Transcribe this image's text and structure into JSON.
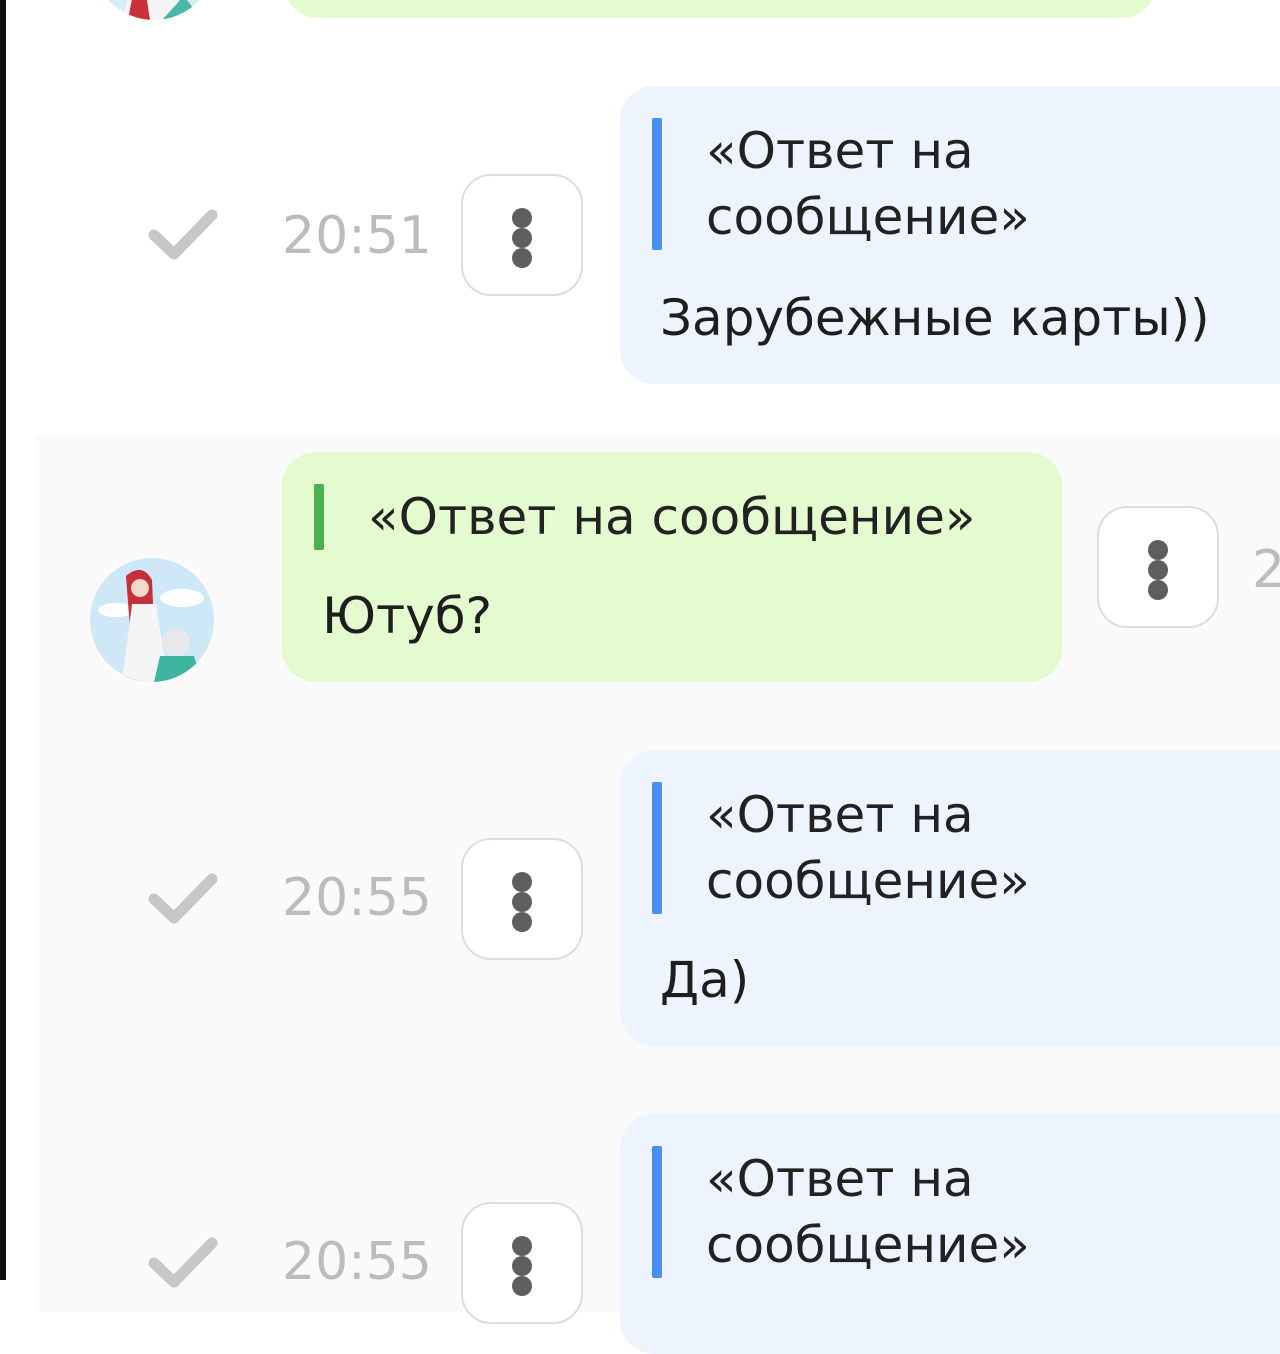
{
  "colors": {
    "outgoing_bubble": "#eef4fe",
    "incoming_bubble": "#e3fbcf",
    "outgoing_quote_bar": "#4a8ef0",
    "incoming_quote_bar": "#4caf50",
    "timestamp": "#bcbcbc",
    "check": "#c7c7c7"
  },
  "messages": [
    {
      "direction": "outgoing",
      "quote": "«Ответ на сообщение»",
      "text": "Зарубежные карты))",
      "time": "20:51",
      "status_icon": "check-icon",
      "menu_icon": "more-vertical-icon"
    },
    {
      "direction": "incoming",
      "quote": "«Ответ на сообщение»",
      "text": "Ютуб?",
      "time_partial": "2",
      "menu_icon": "more-vertical-icon",
      "avatar_icon": "avatar-anime-icon"
    },
    {
      "direction": "outgoing",
      "quote": "«Ответ на сообщение»",
      "text": "Да)",
      "time": "20:55",
      "status_icon": "check-icon",
      "menu_icon": "more-vertical-icon"
    },
    {
      "direction": "outgoing",
      "quote": "«Ответ на сообщение»",
      "text": "",
      "time": "20:55",
      "status_icon": "check-icon",
      "menu_icon": "more-vertical-icon"
    }
  ]
}
